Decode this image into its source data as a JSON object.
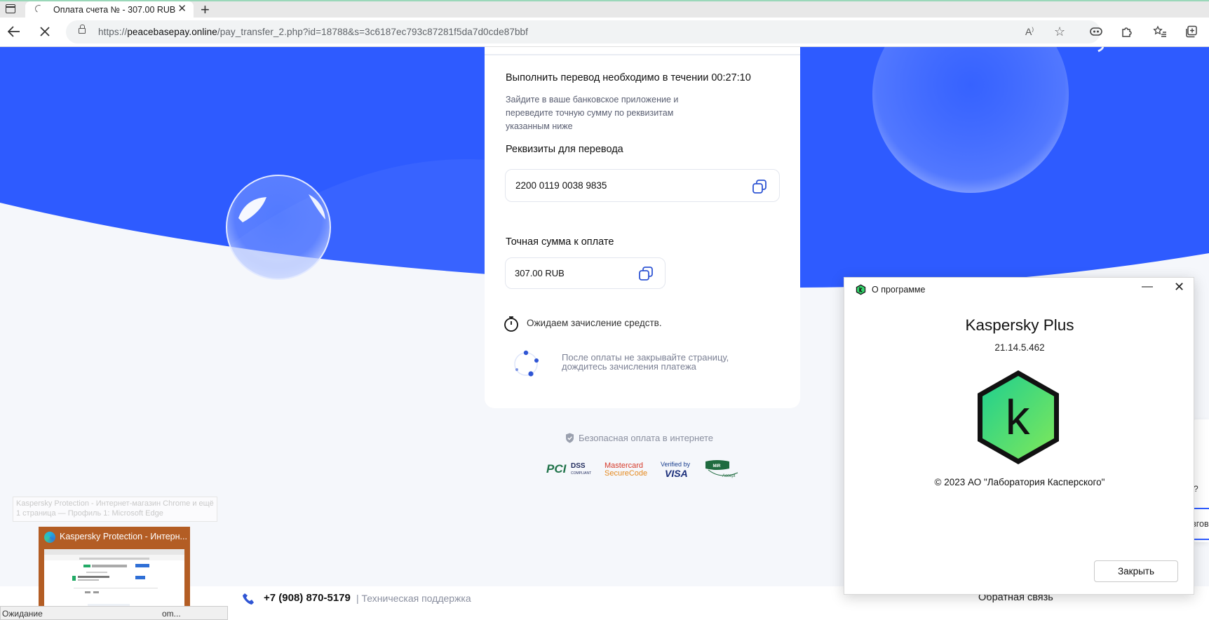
{
  "browser": {
    "tab_title": "Оплата счета № - 307.00 RUB",
    "url_scheme": "https://",
    "url_host": "peacebasepay.online",
    "url_path": "/pay_transfer_2.php?id=18788&s=3c6187ec793c87281f5da7d0cde87bbf",
    "status_text": "Ожидание",
    "status_text_tail": "om..."
  },
  "payment": {
    "timer_text": "Выполнить перевод необходимо в течении 00:27:10",
    "instruction": "Зайдите в ваше банковское приложение и переведите точную сумму по реквизитам указанным ниже",
    "requisites_label": "Реквизиты для перевода",
    "card_number": "2200 0119 0038 9835",
    "exact_sum_label": "Точная сумма к оплате",
    "amount": "307.00 RUB",
    "waiting_text": "Ожидаем зачисление средств.",
    "after_payment": "После оплаты не закрывайте страницу, дождитесь зачисления платежа",
    "secure_text": "Безопасная оплата в интернете",
    "logos": {
      "pci_main": "PCI",
      "pci_dss": "DSS",
      "pci_sub": "COMPLIANT",
      "mc_line1": "Mastercard",
      "mc_line2": "SecureCode",
      "visa_line1": "Verified by",
      "visa_line2": "VISA",
      "mir_main": "MIR",
      "mir_sub": "Accept"
    }
  },
  "footer": {
    "phone": "+7 (908) 870-5179",
    "support": "| Техническая поддержка",
    "feedback": "Обратная связь"
  },
  "taskbar": {
    "ghost_tooltip": "Kaspersky Protection - Интернет-магазин Chrome и ещё 1 страница — Профиль 1: Microsoft Edge",
    "preview_title": "Kaspersky Protection - Интерн..."
  },
  "dialog": {
    "title": "О программе",
    "product": "Kaspersky Plus",
    "version": "21.14.5.462",
    "logo_letter": "k",
    "copyright": "© 2023 АО \"Лаборатория Касперского\"",
    "close_button": "Закрыть"
  },
  "behind_window": {
    "question_fragment": "?",
    "text_fragment": "зговс"
  },
  "colors": {
    "hero_blue": "#2e5bff",
    "kaspersky_green": "#34d46b",
    "accent_blue": "#2f55d4"
  }
}
